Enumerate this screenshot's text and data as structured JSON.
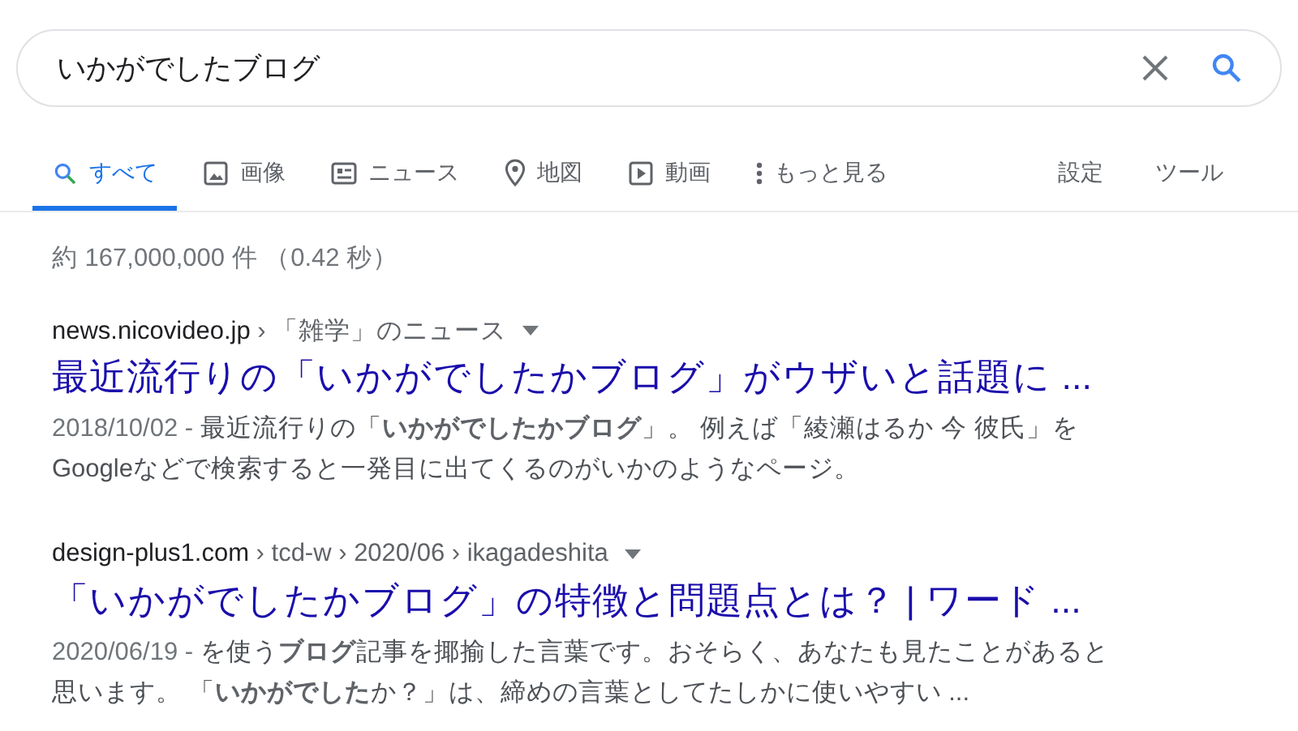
{
  "search": {
    "value": "いかがでしたブログ"
  },
  "tabs": [
    {
      "label": "すべて",
      "kind": "all",
      "selected": true
    },
    {
      "label": "画像",
      "kind": "images",
      "selected": false
    },
    {
      "label": "ニュース",
      "kind": "news",
      "selected": false
    },
    {
      "label": "地図",
      "kind": "maps",
      "selected": false
    },
    {
      "label": "動画",
      "kind": "videos",
      "selected": false
    },
    {
      "label": "もっと見る",
      "kind": "more",
      "selected": false
    }
  ],
  "tools": [
    "設定",
    "ツール"
  ],
  "result_stats": "約 167,000,000 件 （0.42 秒）",
  "results": [
    {
      "site": "news.nicovideo.jp",
      "path": " › 「雑学」のニュース",
      "title": "最近流行りの「いかがでしたかブログ」がウザいと話題に ...",
      "date": "2018/10/02 - ",
      "snippet": "最近流行りの「**いかがでしたかブログ**」。 例えば「綾瀬はるか 今 彼氏」をGoogleなどで検索すると一発目に出てくるのがいかのようなページ。"
    },
    {
      "site": "design-plus1.com",
      "path": " › tcd-w › 2020/06 › ikagadeshita",
      "title": "「いかがでしたかブログ」の特徴と問題点とは？ | ワード ...",
      "date": "2020/06/19 - ",
      "snippet": "を使う**ブログ**記事を揶揄した言葉です。おそらく、あなたも見たことがあると思います。 「**いかがでした**か？」は、締めの言葉としてたしかに使いやすい ..."
    }
  ]
}
